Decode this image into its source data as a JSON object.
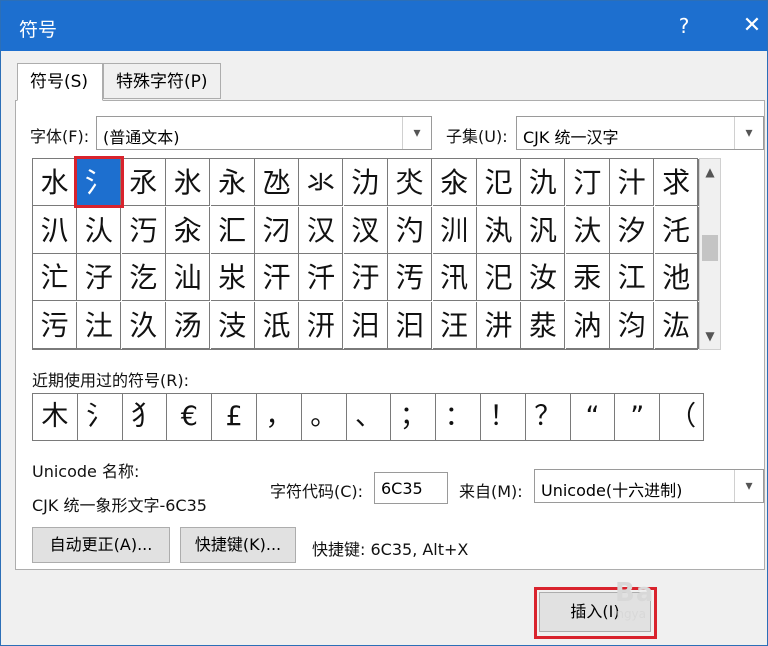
{
  "window": {
    "title": "符号",
    "help_label": "?",
    "close_label": "✕"
  },
  "tabs": [
    {
      "label": "符号(S)",
      "active": true
    },
    {
      "label": "特殊字符(P)",
      "active": false
    }
  ],
  "font": {
    "label": "字体(F):",
    "value": "(普通文本)"
  },
  "subset": {
    "label": "子集(U):",
    "value": "CJK 统一汉字"
  },
  "symbol_grid": {
    "rows": [
      [
        "水",
        "氵",
        "氶",
        "氷",
        "永",
        "氹",
        "氺",
        "氻",
        "氼",
        "氽",
        "氾",
        "氿",
        "汀",
        "汁",
        "求"
      ],
      [
        "汃",
        "汄",
        "汅",
        "汆",
        "汇",
        "汈",
        "汉",
        "汊",
        "汋",
        "汌",
        "汍",
        "汎",
        "汏",
        "汐",
        "汑"
      ],
      [
        "汒",
        "汓",
        "汔",
        "汕",
        "汖",
        "汗",
        "汘",
        "汙",
        "汚",
        "汛",
        "汜",
        "汝",
        "汞",
        "江",
        "池"
      ],
      [
        "污",
        "汢",
        "汣",
        "汤",
        "汥",
        "汦",
        "汧",
        "汨",
        "汩",
        "汪",
        "汫",
        "汬",
        "汭",
        "汮",
        "汯"
      ]
    ],
    "selected_row": 0,
    "selected_col": 1,
    "scroll_position": 0.45
  },
  "recent": {
    "label": "近期使用过的符号(R):",
    "symbols": [
      "木",
      "氵",
      "犭",
      "€",
      "£",
      "，",
      "。",
      "、",
      "；",
      "：",
      "！",
      "？",
      "“",
      "”",
      "（"
    ]
  },
  "unicode_name": {
    "label": "Unicode 名称:",
    "value": "CJK 统一象形文字-6C35"
  },
  "char_code": {
    "label": "字符代码(C):",
    "value": "6C35"
  },
  "from": {
    "label": "来自(M):",
    "value": "Unicode(十六进制)"
  },
  "buttons": {
    "autocorrect": "自动更正(A)...",
    "shortcut_key": "快捷键(K)...",
    "insert": "插入(I)"
  },
  "shortcut_info": "快捷键: 6C35, Alt+X",
  "watermark": {
    "main": "Ba",
    "sub": "ingya"
  },
  "colors": {
    "titlebar": "#1d6fcf",
    "selection": "#1d6fcf",
    "highlight_frame": "#d9232d"
  }
}
